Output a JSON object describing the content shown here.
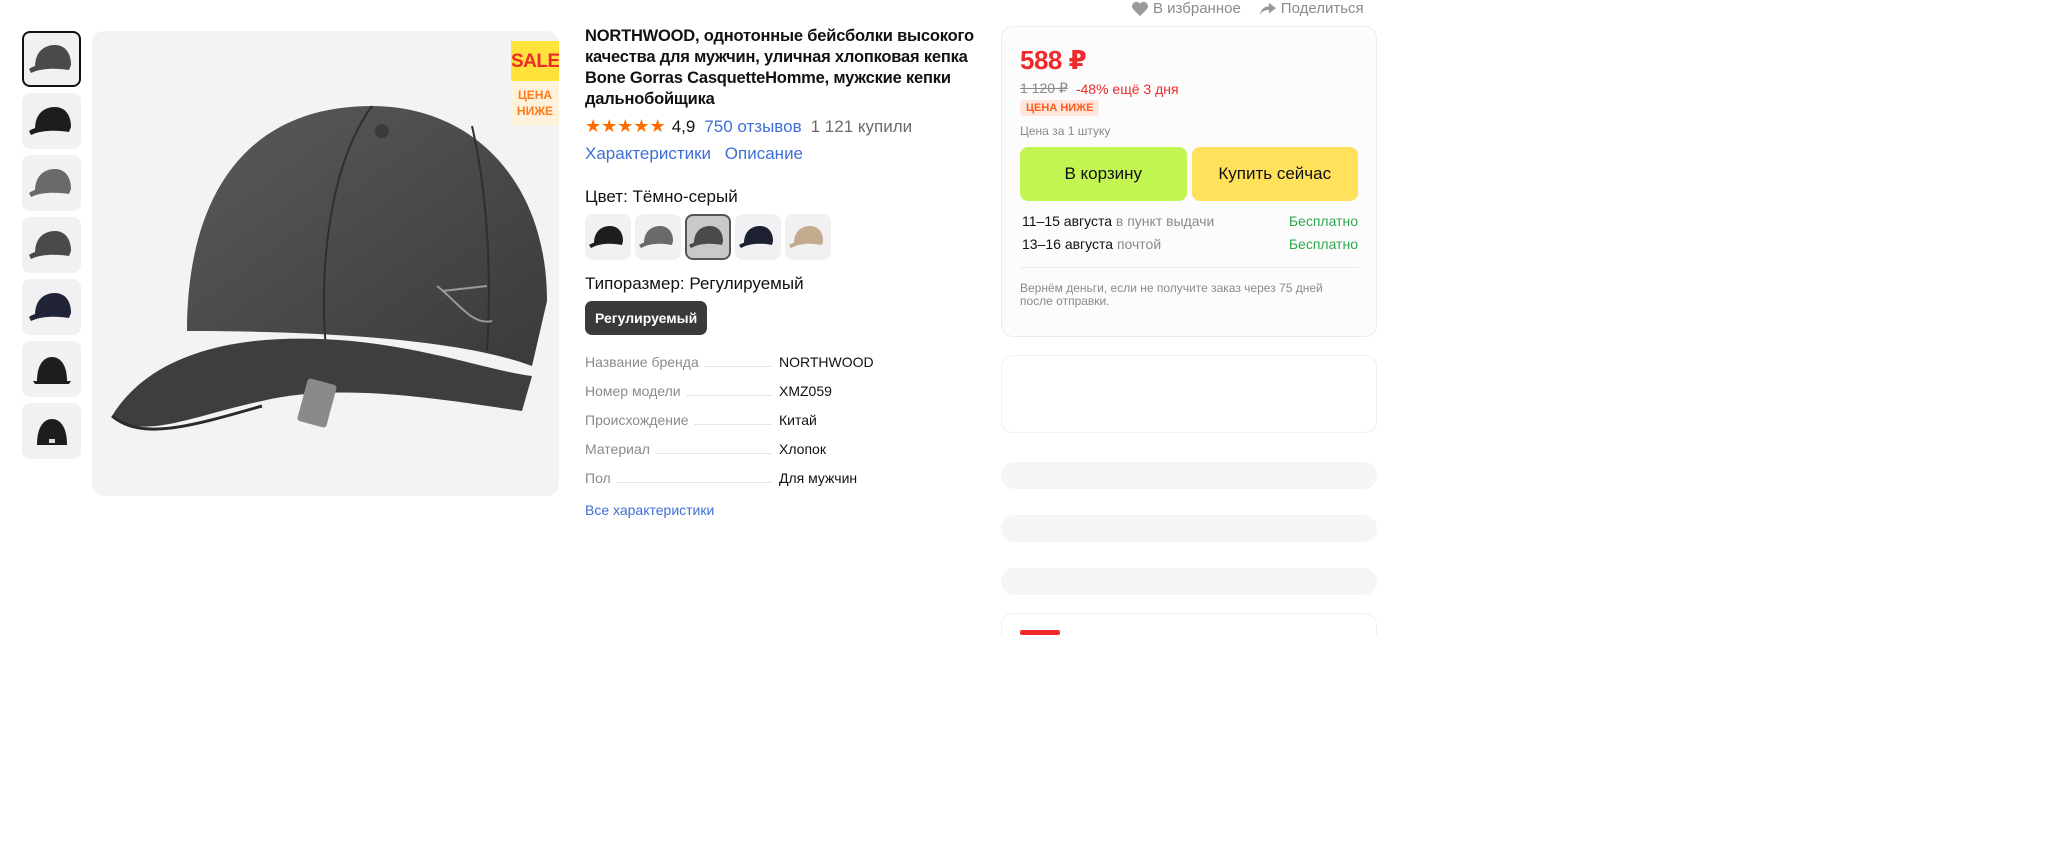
{
  "top_actions": {
    "favorite_label": "В избранное",
    "share_label": "Поделиться"
  },
  "thumbnails": [
    {
      "tone": "#4a4a4a"
    },
    {
      "tone": "#1d1d1d"
    },
    {
      "tone": "#6a6a6a"
    },
    {
      "tone": "#4a4a4a"
    },
    {
      "tone": "#202436"
    },
    {
      "tone": "#1d1d1d"
    },
    {
      "tone": "#1d1d1d"
    }
  ],
  "main_image": {
    "sale_text": "SALE",
    "lower_price_text": "ЦЕНА НИЖЕ",
    "cap_color": "#4a4a4c"
  },
  "product": {
    "title": "NORTHWOOD, однотонные бейсболки высокого качества для мужчин, уличная хлопковая кепка Bone Gorras CasquetteHomme, мужские кепки дальнобойщика",
    "stars": "★★★★★",
    "rating": "4,9",
    "reviews": "750 отзывов",
    "bought": "1 121 купили",
    "link_characteristics": "Характеристики",
    "link_description": "Описание",
    "color_label": "Цвет: Тёмно-серый",
    "colors": [
      {
        "tone": "#1d1d1d"
      },
      {
        "tone": "#6a6a6a"
      },
      {
        "tone": "#4a4a4a"
      },
      {
        "tone": "#1c2030"
      },
      {
        "tone": "#c2ab8e"
      }
    ],
    "size_label": "Типоразмер: Регулируемый",
    "size_option": "Регулируемый",
    "specs": [
      {
        "name": "Название бренда",
        "value": "NORTHWOOD"
      },
      {
        "name": "Номер модели",
        "value": "XMZ059"
      },
      {
        "name": "Происхождение",
        "value": "Китай"
      },
      {
        "name": "Материал",
        "value": "Хлопок"
      },
      {
        "name": "Пол",
        "value": "Для мужчин"
      }
    ],
    "all_specs_link": "Все характеристики"
  },
  "buybox": {
    "price": "588 ₽",
    "old_price": "1 120 ₽",
    "discount": "-48% ещё 3 дня",
    "lower_badge": "ЦЕНА НИЖЕ",
    "per_unit": "Цена за 1 штуку",
    "cart_button": "В корзину",
    "buy_button": "Купить сейчас",
    "delivery": [
      {
        "dates": "11–15 августа",
        "method": "в пункт выдачи",
        "cost": "Бесплатно"
      },
      {
        "dates": "13–16 августа",
        "method": "почтой",
        "cost": "Бесплатно"
      }
    ],
    "refund": "Вернём деньги, если не получите заказ через 75 дней после отправки."
  },
  "colors": {
    "accent_red": "#ef2a2a",
    "link_blue": "#3d6fd6",
    "cart_green": "#c3f552",
    "buy_yellow": "#ffe15c",
    "star_orange": "#ff6b00",
    "free_green": "#2fa84f"
  }
}
